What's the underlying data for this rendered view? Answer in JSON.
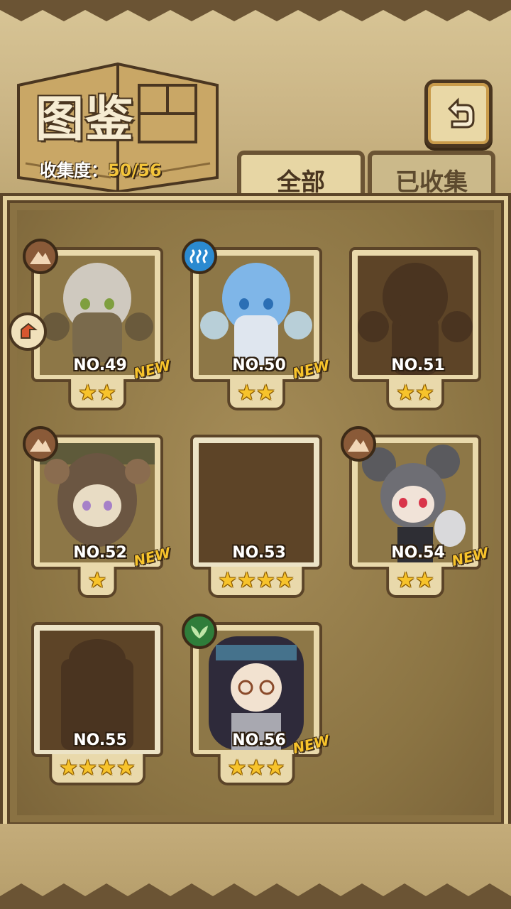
{
  "header": {
    "title": "图鉴",
    "collect_label": "收集度：",
    "collect_value": "50/56"
  },
  "tabs": [
    {
      "label": "全部",
      "active": true
    },
    {
      "label": "已收集",
      "active": false
    }
  ],
  "cards": [
    {
      "no": "NO.49",
      "stars": "★★",
      "new": "NEW",
      "element": "earth-icon",
      "owned": true
    },
    {
      "no": "NO.50",
      "stars": "★★",
      "new": "NEW",
      "element": "water-icon",
      "owned": true
    },
    {
      "no": "NO.51",
      "stars": "★★",
      "new": "",
      "element": "",
      "owned": false
    },
    {
      "no": "NO.52",
      "stars": "★",
      "new": "NEW",
      "element": "earth-icon",
      "owned": true
    },
    {
      "no": "NO.53",
      "stars": "★★★★",
      "new": "",
      "element": "",
      "owned": false
    },
    {
      "no": "NO.54",
      "stars": "★★",
      "new": "NEW",
      "element": "earth-icon",
      "owned": true
    },
    {
      "no": "NO.55",
      "stars": "★★★★",
      "new": "",
      "element": "",
      "owned": false
    },
    {
      "no": "NO.56",
      "stars": "★★★",
      "new": "NEW",
      "element": "grass-icon",
      "owned": true
    }
  ],
  "colors": {
    "star": "#f7c32b",
    "new_badge": "#f7c32b",
    "panel": "#8a7243",
    "earth": "#8a5a38",
    "water": "#2b8ad0",
    "grass": "#2f7d3a"
  }
}
